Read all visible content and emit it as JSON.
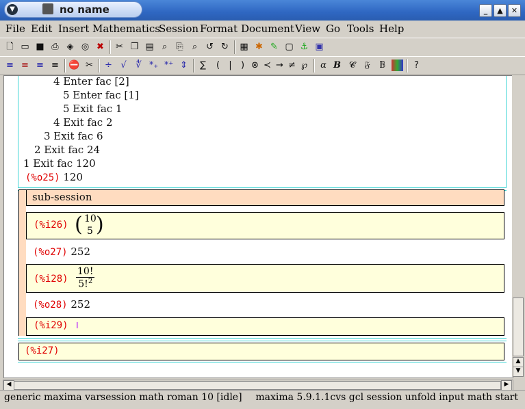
{
  "window": {
    "title": "no name"
  },
  "menu": [
    "File",
    "Edit",
    "Insert",
    "Mathematics",
    "Session",
    "Format",
    "Document",
    "View",
    "Go",
    "Tools",
    "Help"
  ],
  "trace_lines": [
    {
      "text": "4 Enter fac [2]"
    },
    {
      "text": "5 Enter fac [1]"
    },
    {
      "text": "5 Exit fac 1"
    },
    {
      "text": "4 Exit fac 2"
    },
    {
      "text": "3 Exit fac 6"
    },
    {
      "text": "2 Exit fac 24"
    },
    {
      "text": "1 Exit fac 120"
    }
  ],
  "outputs": {
    "o25_label": "(%o25)",
    "o25_value": "120",
    "subsession_title": "sub-session",
    "i26_label": "(%i26)",
    "i26_binom_top": "10",
    "i26_binom_bottom": "5",
    "o27_label": "(%o27)",
    "o27_value": "252",
    "i28_label": "(%i28)",
    "i28_num": "10!",
    "i28_den": "5!",
    "i28_den_exp": "2",
    "o28_label": "(%o28)",
    "o28_value": "252",
    "i29_label": "(%i29)",
    "i29_cursor": "I",
    "i27_label": "(%i27)"
  },
  "toolbar2_symbols": [
    "∑",
    "(",
    "|",
    ")",
    "⊗",
    "≺",
    "→",
    "≠",
    "℘",
    "α",
    "B",
    "𝓒",
    "𝔉",
    "𝔹",
    "?"
  ],
  "status": {
    "left": "generic maxima varsession math roman 10 [idle]",
    "right": "maxima 5.9.1.1cvs gcl session unfold input math start"
  },
  "colors": {
    "label_red": "#e00000",
    "input_bg": "#ffffdc",
    "subsession_bg": "#ffdcc0",
    "frame_cyan": "#3fd5d5"
  }
}
